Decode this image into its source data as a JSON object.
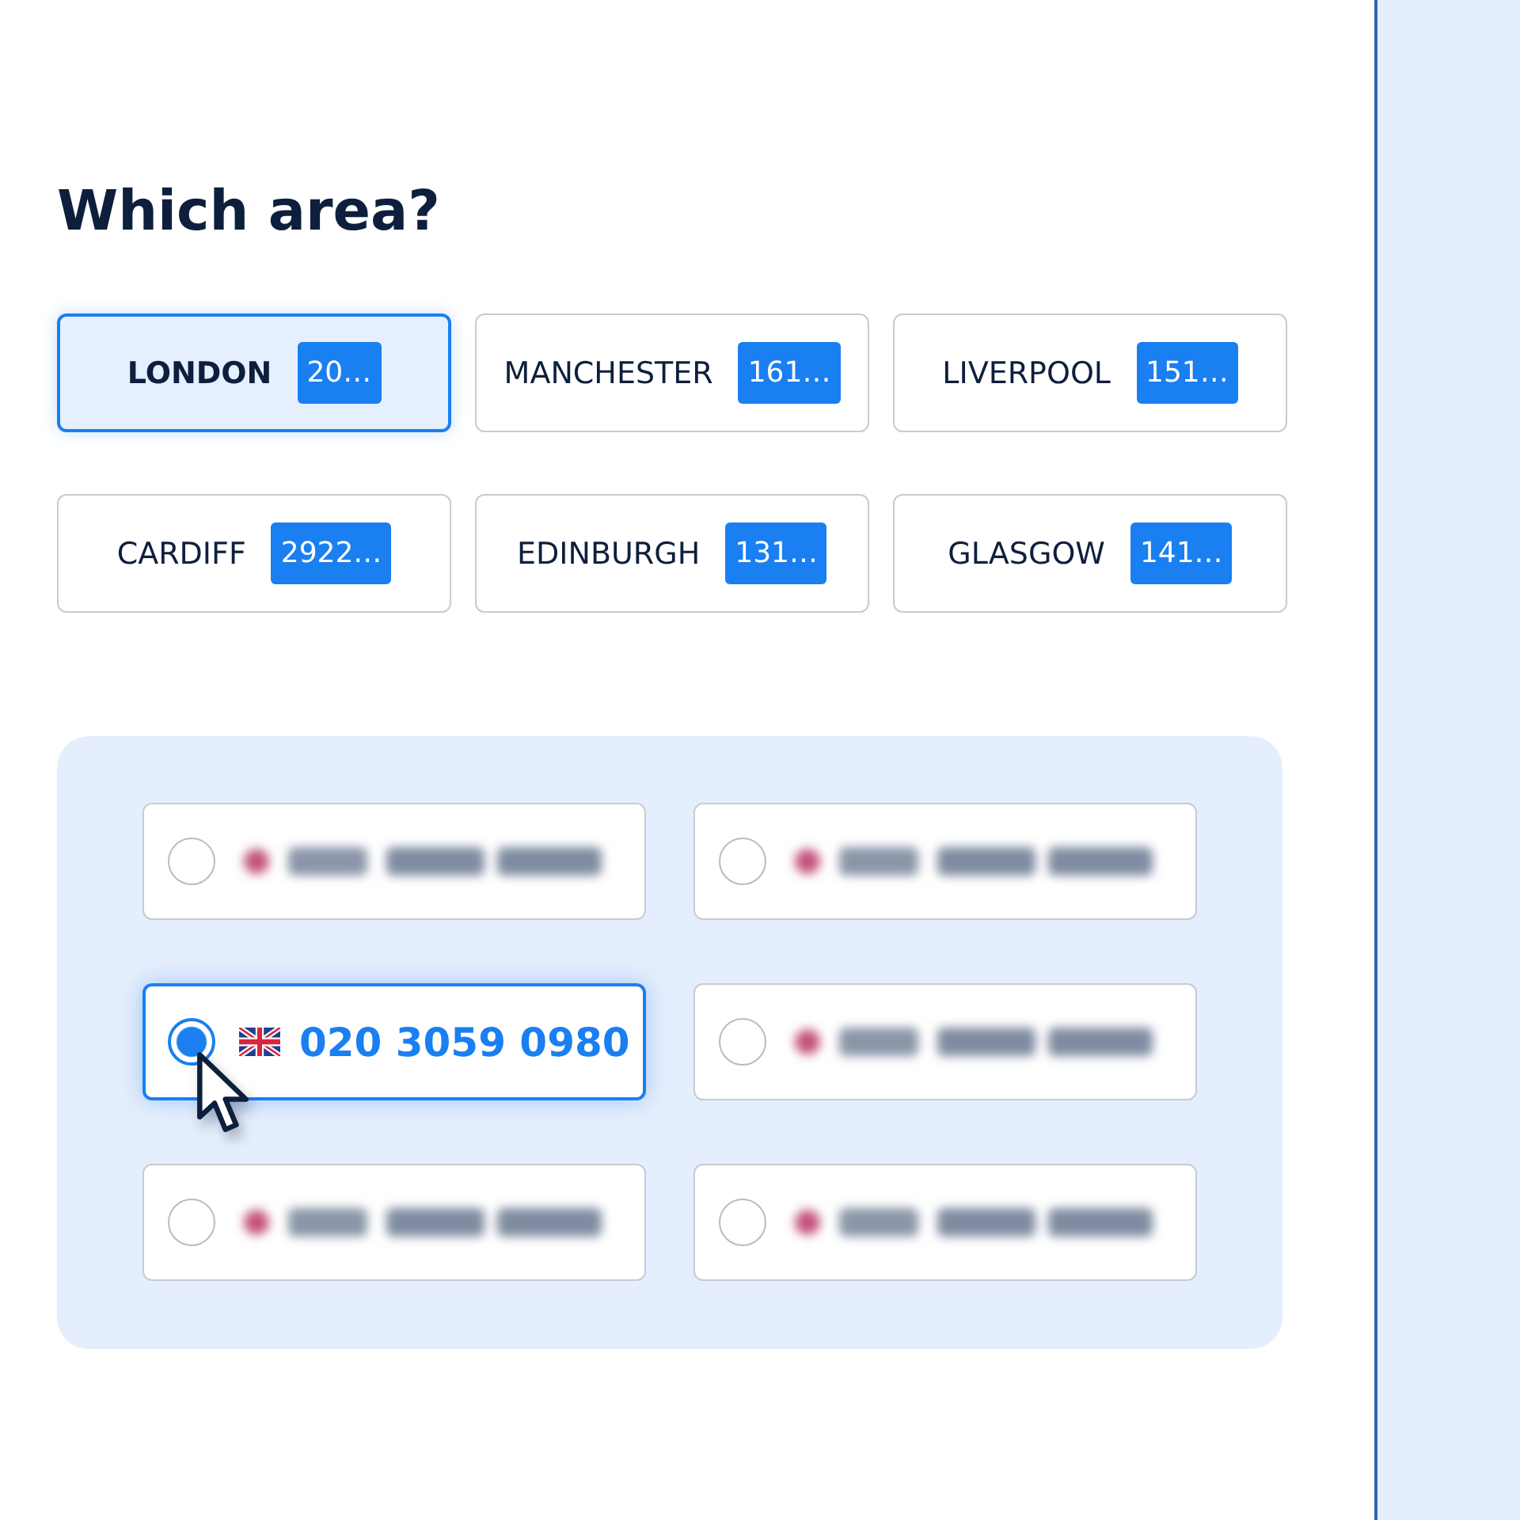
{
  "heading": "Which area?",
  "areas": [
    {
      "name": "LONDON",
      "count": "20…",
      "selected": true
    },
    {
      "name": "MANCHESTER",
      "count": "161…",
      "selected": false
    },
    {
      "name": "LIVERPOOL",
      "count": "151…",
      "selected": false
    },
    {
      "name": "CARDIFF",
      "count": "2922…",
      "selected": false
    },
    {
      "name": "EDINBURGH",
      "count": "131…",
      "selected": false
    },
    {
      "name": "GLASGOW",
      "count": "141…",
      "selected": false
    }
  ],
  "numbers": {
    "options": [
      {
        "kind": "blurred",
        "selected": false
      },
      {
        "kind": "blurred",
        "selected": false
      },
      {
        "kind": "clear",
        "number": "020 3059 0980",
        "selected": true
      },
      {
        "kind": "blurred",
        "selected": false
      },
      {
        "kind": "blurred",
        "selected": false
      },
      {
        "kind": "blurred",
        "selected": false
      }
    ]
  }
}
